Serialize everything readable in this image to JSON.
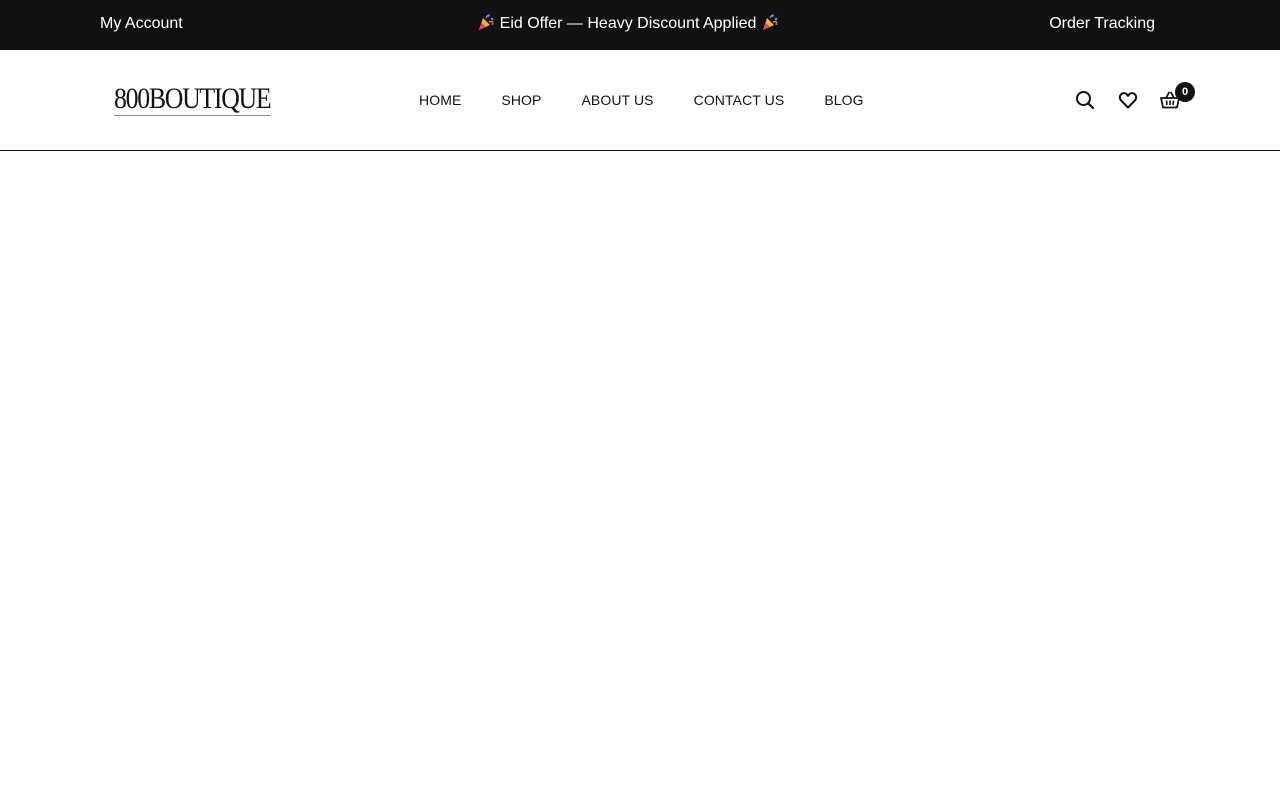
{
  "topbar": {
    "my_account": "My Account",
    "offer_text": "Eid Offer — Heavy Discount Applied",
    "order_tracking": "Order Tracking",
    "offer_icon": "party-popper-icon"
  },
  "header": {
    "logo": "800BOUTIQUE",
    "nav": [
      {
        "label": "HOME"
      },
      {
        "label": "SHOP"
      },
      {
        "label": "ABOUT US"
      },
      {
        "label": "CONTACT US"
      },
      {
        "label": "BLOG"
      }
    ],
    "icons": [
      "search-icon",
      "heart-icon",
      "basket-icon"
    ],
    "cart_count": "0"
  },
  "colors": {
    "topbar_bg": "#111111",
    "text": "#111111",
    "background": "#ffffff"
  }
}
